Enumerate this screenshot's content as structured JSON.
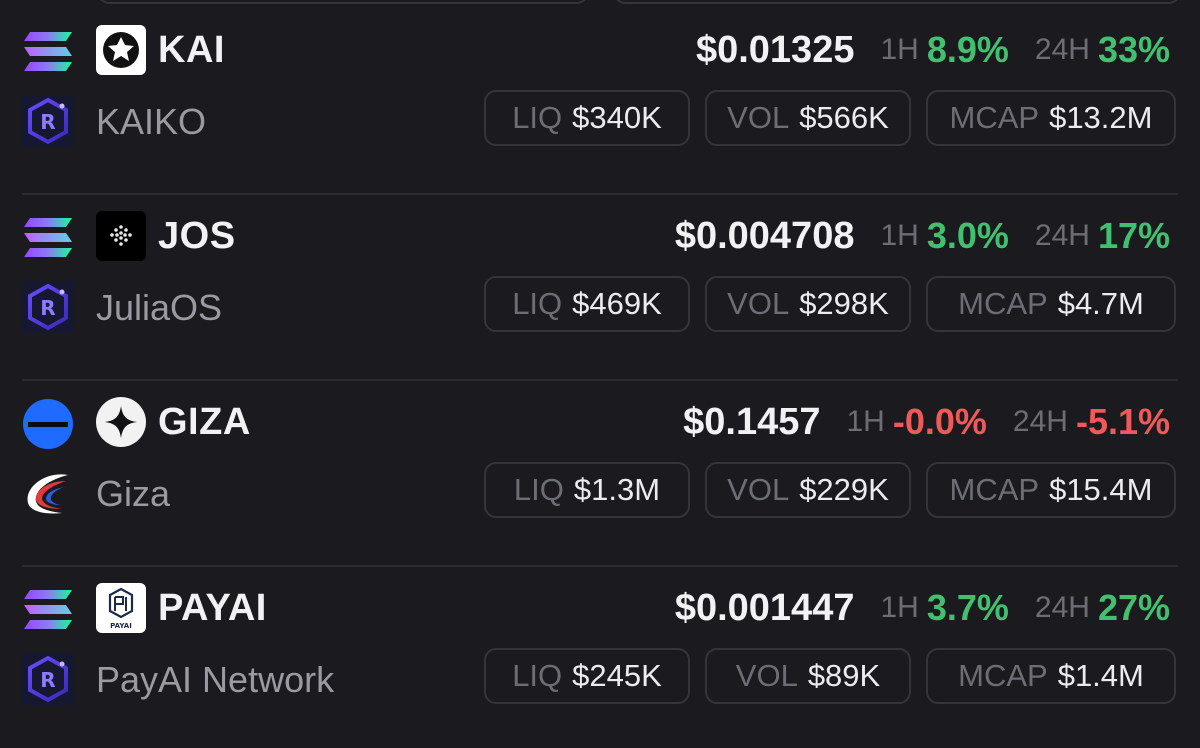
{
  "colors": {
    "background": "#1b1b1f",
    "positive": "#43c06f",
    "negative": "#ee5a5a",
    "muted": "#6d6d76",
    "border": "#34343a"
  },
  "labels": {
    "h1": "1H",
    "h24": "24H",
    "liq": "LIQ",
    "vol": "VOL",
    "mcap": "MCAP"
  },
  "tokens": [
    {
      "chain_icon": "solana-icon",
      "dex_icon": "raydium-icon",
      "logo_icon": "kaia-logo-icon",
      "symbol": "KAI",
      "name": "KAIKO",
      "price": "$0.01325",
      "change_1h": "8.9%",
      "change_24h": "33%",
      "change_1h_dir": "up",
      "change_24h_dir": "up",
      "liq": "$340K",
      "vol": "$566K",
      "mcap": "$13.2M"
    },
    {
      "chain_icon": "solana-icon",
      "dex_icon": "raydium-icon",
      "logo_icon": "julia-dots-logo-icon",
      "symbol": "JOS",
      "name": "JuliaOS",
      "price": "$0.004708",
      "change_1h": "3.0%",
      "change_24h": "17%",
      "change_1h_dir": "up",
      "change_24h_dir": "up",
      "liq": "$469K",
      "vol": "$298K",
      "mcap": "$4.7M"
    },
    {
      "chain_icon": "base-icon",
      "dex_icon": "giza-swoosh-icon",
      "logo_icon": "star-logo-icon",
      "symbol": "GIZA",
      "name": "Giza",
      "price": "$0.1457",
      "change_1h": "-0.0%",
      "change_24h": "-5.1%",
      "change_1h_dir": "down",
      "change_24h_dir": "down",
      "liq": "$1.3M",
      "vol": "$229K",
      "mcap": "$15.4M"
    },
    {
      "chain_icon": "solana-icon",
      "dex_icon": "raydium-icon",
      "logo_icon": "payai-logo-icon",
      "logo_text": "PAYAI",
      "symbol": "PAYAI",
      "name": "PayAI Network",
      "price": "$0.001447",
      "change_1h": "3.7%",
      "change_24h": "27%",
      "change_1h_dir": "up",
      "change_24h_dir": "up",
      "liq": "$245K",
      "vol": "$89K",
      "mcap": "$1.4M"
    }
  ]
}
